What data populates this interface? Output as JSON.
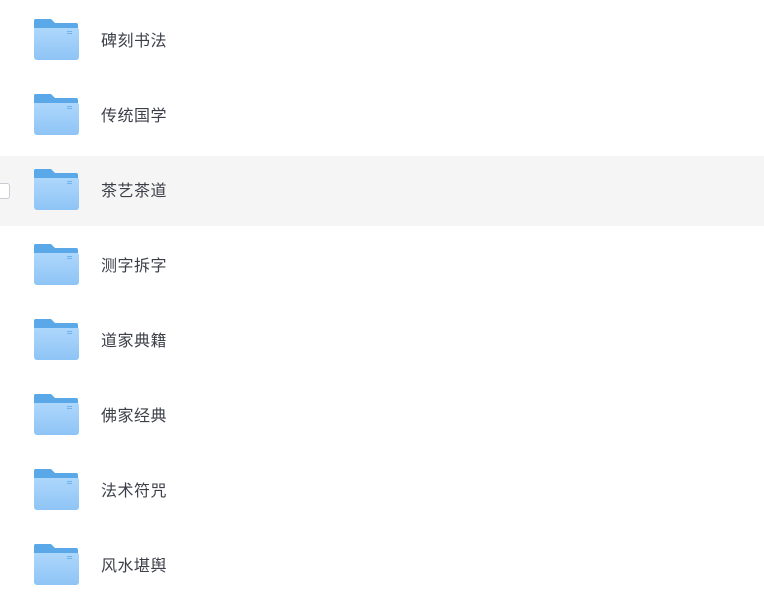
{
  "files": [
    {
      "name": "碑刻书法",
      "icon": "folder-icon"
    },
    {
      "name": "传统国学",
      "icon": "folder-icon"
    },
    {
      "name": "茶艺茶道",
      "icon": "folder-icon",
      "hovered": true
    },
    {
      "name": "测字拆字",
      "icon": "folder-icon"
    },
    {
      "name": "道家典籍",
      "icon": "folder-icon"
    },
    {
      "name": "佛家经典",
      "icon": "folder-icon"
    },
    {
      "name": "法术符咒",
      "icon": "folder-icon"
    },
    {
      "name": "风水堪舆",
      "icon": "folder-icon"
    }
  ],
  "colors": {
    "folder_back": "#5aa8e8",
    "folder_front_top": "#a9d4fb",
    "folder_front_bottom": "#8cc3f5",
    "hover_background": "#f5f5f6",
    "text": "#3c3f48"
  }
}
